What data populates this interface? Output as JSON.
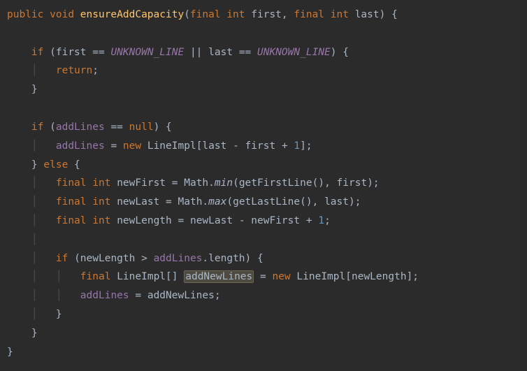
{
  "kw": {
    "public": "public",
    "void": "void",
    "final": "final",
    "int": "int",
    "if": "if",
    "else": "else",
    "return": "return",
    "new": "new",
    "null": "null"
  },
  "fn": {
    "ensureAddCapacity": "ensureAddCapacity",
    "min": "min",
    "max": "max",
    "getFirstLine": "getFirstLine",
    "getLastLine": "getLastLine"
  },
  "id": {
    "first": "first",
    "last": "last",
    "UNKNOWN_LINE": "UNKNOWN_LINE",
    "addLines": "addLines",
    "LineImpl": "LineImpl",
    "newFirst": "newFirst",
    "newLast": "newLast",
    "newLength": "newLength",
    "addNewLines": "addNewLines",
    "Math": "Math",
    "length": "length"
  },
  "num": {
    "one": "1"
  },
  "op": {
    "lparen": "(",
    "rparen": ")",
    "lbrace": "{",
    "rbrace": "}",
    "lbrack": "[",
    "rbrack": "]",
    "comma": ",",
    "semi": ";",
    "eq": "=",
    "eqeq": "==",
    "oror": "||",
    "gt": ">",
    "minus": "-",
    "plus": "+",
    "dot": "."
  }
}
